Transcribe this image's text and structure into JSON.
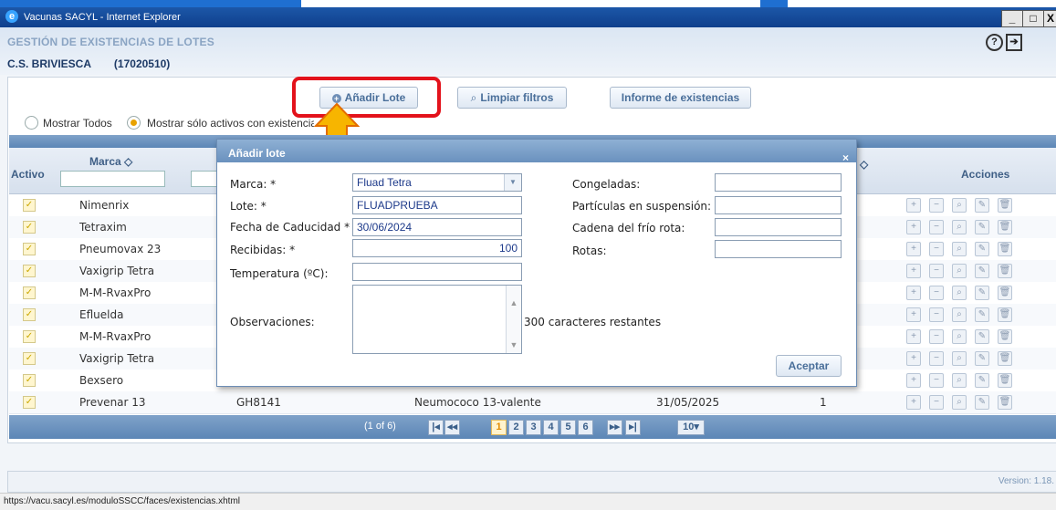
{
  "window": {
    "title": "Vacunas SACYL - Internet Explorer",
    "min": "_",
    "max": "□",
    "close": "X"
  },
  "app": {
    "title": "GESTIÓN DE EXISTENCIAS DE LOTES",
    "center_name": "C.S. BRIVIESCA",
    "center_code": "(17020510)"
  },
  "toolbar": {
    "add_lote": "Añadir Lote",
    "clear_filters": "Limpiar filtros",
    "stock_report": "Informe de existencias"
  },
  "filters": {
    "show_all": "Mostrar Todos",
    "show_active": "Mostrar sólo activos con existencia"
  },
  "grid": {
    "headers": {
      "activo": "Activo",
      "marca": "Marca ◇",
      "acciones": "Acciones",
      "sort_marker": "◇"
    },
    "rows": [
      {
        "marca": "Nimenrix"
      },
      {
        "marca": "Tetraxim"
      },
      {
        "marca": "Pneumovax 23"
      },
      {
        "marca": "Vaxigrip Tetra"
      },
      {
        "marca": "M-M-RvaxPro"
      },
      {
        "marca": "Efluelda"
      },
      {
        "marca": "M-M-RvaxPro"
      },
      {
        "marca": "Vaxigrip Tetra"
      },
      {
        "marca": "Bexsero"
      },
      {
        "marca": "Prevenar 13",
        "lote": "GH8141",
        "tipo": "Neumococo 13-valente",
        "caducidad": "31/05/2025",
        "existencias": "1"
      }
    ]
  },
  "pager": {
    "summary": "(1 of 6)",
    "pages": [
      "1",
      "2",
      "3",
      "4",
      "5",
      "6"
    ],
    "per_page": "10",
    "first": "|◂",
    "prev": "◂◂",
    "next": "▸▸",
    "last": "▸|"
  },
  "version": "Version: 1.18.",
  "status_url": "https://vacu.sacyl.es/moduloSSCC/faces/existencias.xhtml",
  "dialog": {
    "title": "Añadir lote",
    "close": "×",
    "labels": {
      "marca": "Marca: *",
      "lote": "Lote: *",
      "caducidad": "Fecha de Caducidad *",
      "recibidas": "Recibidas: *",
      "temperatura": "Temperatura (ºC):",
      "observaciones": "Observaciones:",
      "congeladas": "Congeladas:",
      "particulas": "Partículas en suspensión:",
      "cadena": "Cadena del frío rota:",
      "rotas": "Rotas:"
    },
    "values": {
      "marca": "Fluad Tetra",
      "lote": "FLUADPRUEBA",
      "caducidad": "30/06/2024",
      "recibidas": "100"
    },
    "chars_remaining": "300 caracteres restantes",
    "accept": "Aceptar"
  },
  "colors": {
    "accent": "#5c86b6",
    "highlight_box": "#e3121b",
    "arrow": "#f7b500"
  }
}
